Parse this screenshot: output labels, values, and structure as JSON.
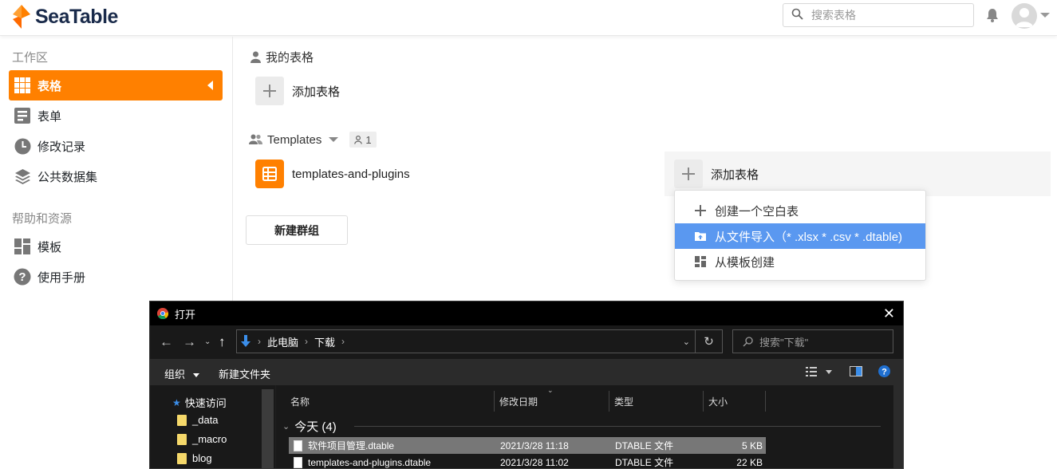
{
  "header": {
    "logo_text": "SeaTable",
    "search_placeholder": "搜索表格"
  },
  "sidebar": {
    "workspace_title": "工作区",
    "items": [
      {
        "label": "表格",
        "icon": "grid-icon",
        "active": true
      },
      {
        "label": "表单",
        "icon": "form-icon"
      },
      {
        "label": "修改记录",
        "icon": "clock-icon"
      },
      {
        "label": "公共数据集",
        "icon": "layers-icon"
      }
    ],
    "help_title": "帮助和资源",
    "help_items": [
      {
        "label": "模板",
        "icon": "template-icon"
      },
      {
        "label": "使用手册",
        "icon": "help-icon"
      }
    ]
  },
  "main": {
    "my_tables_label": "我的表格",
    "add_table_label": "添加表格",
    "group_name": "Templates",
    "group_member_count": "1",
    "group_table_name": "templates-and-plugins",
    "group_add_table_label": "添加表格",
    "new_group_label": "新建群组"
  },
  "dropdown": {
    "items": [
      {
        "label": "创建一个空白表",
        "icon": "plus-icon"
      },
      {
        "label": "从文件导入（* .xlsx * .csv * .dtable)",
        "icon": "upload-icon",
        "active": true
      },
      {
        "label": "从模板创建",
        "icon": "template-icon"
      }
    ]
  },
  "dialog": {
    "title": "打开",
    "close": "✕",
    "path": [
      "此电脑",
      "下载"
    ],
    "search_placeholder": "搜索\"下载\"",
    "organize_label": "组织",
    "new_folder_label": "新建文件夹",
    "nav": {
      "quick_access": "快速访问",
      "folders": [
        "_data",
        "_macro",
        "blog"
      ]
    },
    "columns": {
      "name": "名称",
      "modified": "修改日期",
      "type": "类型",
      "size": "大小"
    },
    "group_label": "今天 (4)",
    "files": [
      {
        "name": "软件项目管理.dtable",
        "modified": "2021/3/28 11:18",
        "type": "DTABLE 文件",
        "size": "5 KB",
        "selected": true
      },
      {
        "name": "templates-and-plugins.dtable",
        "modified": "2021/3/28 11:02",
        "type": "DTABLE 文件",
        "size": "22 KB"
      }
    ]
  },
  "colors": {
    "brand_orange": "#ff8000",
    "dropdown_highlight": "#5a98f0",
    "logo_navy": "#1a2b4b"
  }
}
